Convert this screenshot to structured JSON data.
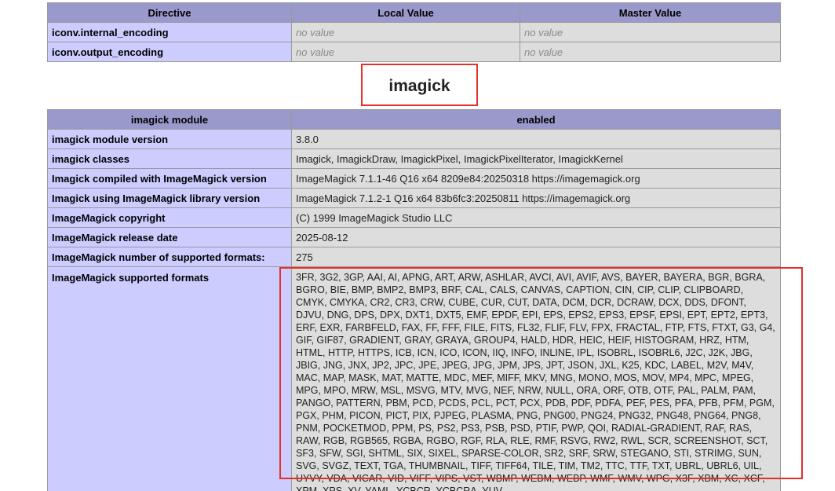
{
  "directive_table": {
    "headers": [
      "Directive",
      "Local Value",
      "Master Value"
    ],
    "rows": [
      {
        "name": "iconv.internal_encoding",
        "local": "no value",
        "master": "no value"
      },
      {
        "name": "iconv.output_encoding",
        "local": "no value",
        "master": "no value"
      }
    ]
  },
  "imagick": {
    "title": "imagick",
    "header": {
      "name": "imagick module",
      "value": "enabled"
    },
    "rows": [
      {
        "name": "imagick module version",
        "value": "3.8.0"
      },
      {
        "name": "imagick classes",
        "value": "Imagick, ImagickDraw, ImagickPixel, ImagickPixelIterator, ImagickKernel"
      },
      {
        "name": "Imagick compiled with ImageMagick version",
        "value": "ImageMagick 7.1.1-46 Q16 x64 8209e84:20250318 https://imagemagick.org"
      },
      {
        "name": "Imagick using ImageMagick library version",
        "value": "ImageMagick 7.1.2-1 Q16 x64 83b6fc3:20250811 https://imagemagick.org"
      },
      {
        "name": "ImageMagick copyright",
        "value": "(C) 1999 ImageMagick Studio LLC"
      },
      {
        "name": "ImageMagick release date",
        "value": "2025-08-12"
      },
      {
        "name": "ImageMagick number of supported formats:",
        "value": "275"
      }
    ],
    "formats_label": "ImageMagick supported formats",
    "formats": "3FR, 3G2, 3GP, AAI, AI, APNG, ART, ARW, ASHLAR, AVCI, AVI, AVIF, AVS, BAYER, BAYERA, BGR, BGRA, BGRO, BIE, BMP, BMP2, BMP3, BRF, CAL, CALS, CANVAS, CAPTION, CIN, CIP, CLIP, CLIPBOARD, CMYK, CMYKA, CR2, CR3, CRW, CUBE, CUR, CUT, DATA, DCM, DCR, DCRAW, DCX, DDS, DFONT, DJVU, DNG, DPS, DPX, DXT1, DXT5, EMF, EPDF, EPI, EPS, EPS2, EPS3, EPSF, EPSI, EPT, EPT2, EPT3, ERF, EXR, FARBFELD, FAX, FF, FFF, FILE, FITS, FL32, FLIF, FLV, FPX, FRACTAL, FTP, FTS, FTXT, G3, G4, GIF, GIF87, GRADIENT, GRAY, GRAYA, GROUP4, HALD, HDR, HEIC, HEIF, HISTOGRAM, HRZ, HTM, HTML, HTTP, HTTPS, ICB, ICN, ICO, ICON, IIQ, INFO, INLINE, IPL, ISOBRL, ISOBRL6, J2C, J2K, JBG, JBIG, JNG, JNX, JP2, JPC, JPE, JPEG, JPG, JPM, JPS, JPT, JSON, JXL, K25, KDC, LABEL, M2V, M4V, MAC, MAP, MASK, MAT, MATTE, MDC, MEF, MIFF, MKV, MNG, MONO, MOS, MOV, MP4, MPC, MPEG, MPG, MPO, MRW, MSL, MSVG, MTV, MVG, NEF, NRW, NULL, ORA, ORF, OTB, OTF, PAL, PALM, PAM, PANGO, PATTERN, PBM, PCD, PCDS, PCL, PCT, PCX, PDB, PDF, PDFA, PEF, PES, PFA, PFB, PFM, PGM, PGX, PHM, PICON, PICT, PIX, PJPEG, PLASMA, PNG, PNG00, PNG24, PNG32, PNG48, PNG64, PNG8, PNM, POCKETMOD, PPM, PS, PS2, PS3, PSB, PSD, PTIF, PWP, QOI, RADIAL-GRADIENT, RAF, RAS, RAW, RGB, RGB565, RGBA, RGBO, RGF, RLA, RLE, RMF, RSVG, RW2, RWL, SCR, SCREENSHOT, SCT, SF3, SFW, SGI, SHTML, SIX, SIXEL, SPARSE-COLOR, SR2, SRF, SRW, STEGANO, STI, STRIMG, SUN, SVG, SVGZ, TEXT, TGA, THUMBNAIL, TIFF, TIFF64, TILE, TIM, TM2, TTC, TTF, TXT, UBRL, UBRL6, UIL, UYVY, VDA, VICAR, VID, VIFF, VIPS, VST, WBMP, WEBM, WEBP, WMF, WMV, WPG, X3F, XBM, XC, XCF, XPM, XPS, XV, YAML, YCBCR, YCBCRA, YUV"
  },
  "colors": {
    "header_bg": "#9999cc",
    "key_bg": "#ccccff",
    "value_bg": "#dddddd",
    "highlight_border": "#e0312b"
  }
}
